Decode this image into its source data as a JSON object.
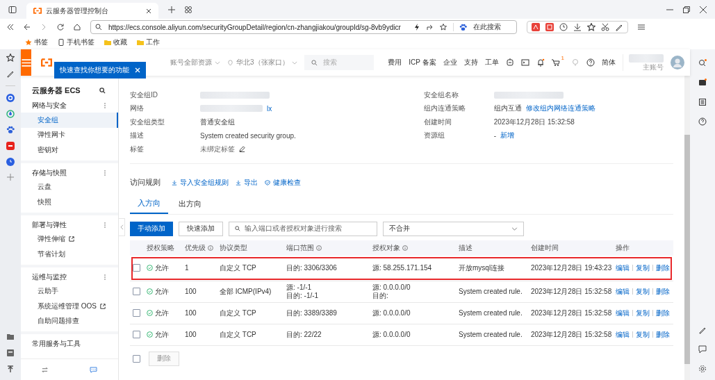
{
  "browser": {
    "tab_title": "云服务器管理控制台",
    "url": "https://ecs.console.aliyun.com/securityGroupDetail/region/cn-zhangjiakou/groupId/sg-8vb9ydicr",
    "search_placeholder": "在此搜索",
    "bookmarks": [
      {
        "label": "书签",
        "kind": "star"
      },
      {
        "label": "手机书签",
        "kind": "phone"
      },
      {
        "label": "收藏",
        "kind": "folder"
      },
      {
        "label": "工作",
        "kind": "folder"
      }
    ]
  },
  "topbar": {
    "resource_scope": "账号全部资源",
    "region": "华北3（张家口）",
    "search_placeholder": "搜索",
    "links": [
      "费用",
      "ICP 备案",
      "企业",
      "支持",
      "工单"
    ],
    "cart_count": "1",
    "language": "简体",
    "account_label": "主账号"
  },
  "tooltip": "快速查找你想要的功能",
  "sidebar": {
    "title": "云服务器 ECS",
    "sections": [
      {
        "title": "网络与安全",
        "items": [
          {
            "label": "安全组",
            "selected": true,
            "external": false
          },
          {
            "label": "弹性网卡",
            "selected": false,
            "external": false
          },
          {
            "label": "密钥对",
            "selected": false,
            "external": false
          }
        ]
      },
      {
        "title": "存储与快照",
        "items": [
          {
            "label": "云盘",
            "selected": false,
            "external": false
          },
          {
            "label": "快照",
            "selected": false,
            "external": false
          }
        ]
      },
      {
        "title": "部署与弹性",
        "items": [
          {
            "label": "弹性伸缩",
            "selected": false,
            "external": true
          },
          {
            "label": "节省计划",
            "selected": false,
            "external": false
          }
        ]
      },
      {
        "title": "运维与监控",
        "items": [
          {
            "label": "云助手",
            "selected": false,
            "external": false
          },
          {
            "label": "系统运维管理 OOS",
            "selected": false,
            "external": true
          },
          {
            "label": "自助问题排查",
            "selected": false,
            "external": false
          }
        ]
      },
      {
        "title": "常用服务与工具"
      }
    ]
  },
  "details": {
    "left": [
      {
        "label": "安全组ID",
        "kind": "redacted"
      },
      {
        "label": "网络",
        "kind": "redacted-link",
        "value": "lx"
      },
      {
        "label": "安全组类型",
        "kind": "text",
        "value": "普通安全组"
      },
      {
        "label": "描述",
        "kind": "text",
        "value": "System created security group."
      },
      {
        "label": "标签",
        "kind": "tag",
        "value": "未绑定标签"
      }
    ],
    "right": [
      {
        "label": "安全组名称",
        "kind": "redacted"
      },
      {
        "label": "组内连通策略",
        "kind": "text-link",
        "value": "组内互通",
        "link": "修改组内网络连通策略"
      },
      {
        "label": "创建时间",
        "kind": "text",
        "value": "2023年12月28日 15:32:58"
      },
      {
        "label": "资源组",
        "kind": "text-link",
        "value": "-",
        "link": "新增"
      }
    ]
  },
  "rules": {
    "title": "访问规则",
    "actions": [
      {
        "label": "导入安全组规则",
        "kind": "download"
      },
      {
        "label": "导出",
        "kind": "download"
      },
      {
        "label": "健康检查",
        "kind": "shield"
      }
    ],
    "tabs": [
      {
        "label": "入方向",
        "selected": true
      },
      {
        "label": "出方向",
        "selected": false
      }
    ],
    "add_button": "手动添加",
    "quick_add_button": "快速添加",
    "search_placeholder": "输入端口或者授权对象进行搜索",
    "merge_select": "不合并",
    "columns": [
      {
        "label": "授权策略",
        "info": false
      },
      {
        "label": "优先级",
        "info": true
      },
      {
        "label": "协议类型",
        "info": false
      },
      {
        "label": "端口范围",
        "info": true
      },
      {
        "label": "授权对象",
        "info": true
      },
      {
        "label": "描述",
        "info": false
      },
      {
        "label": "创建时间",
        "info": false
      },
      {
        "label": "操作",
        "info": false
      }
    ],
    "rows": [
      {
        "checked": false,
        "highlighted": true,
        "policy": "允许",
        "priority": "1",
        "protocol": "自定义 TCP",
        "port": [
          "目的: 3306/3306"
        ],
        "object": [
          "源: 58.255.171.154"
        ],
        "description": "开放mysql连接",
        "created": "2023年12月28日 19:43:23",
        "actions": [
          "编辑",
          "复制",
          "删除"
        ]
      },
      {
        "checked": false,
        "highlighted": false,
        "policy": "允许",
        "priority": "100",
        "protocol": "全部 ICMP(IPv4)",
        "port": [
          "源: -1/-1",
          "目的: -1/-1"
        ],
        "object": [
          "源: 0.0.0.0/0",
          "目的:"
        ],
        "description": "System created rule.",
        "created": "2023年12月28日 15:32:58",
        "actions": [
          "编辑",
          "复制",
          "删除"
        ]
      },
      {
        "checked": false,
        "highlighted": false,
        "policy": "允许",
        "priority": "100",
        "protocol": "自定义 TCP",
        "port": [
          "目的: 3389/3389"
        ],
        "object": [
          "源: 0.0.0.0/0"
        ],
        "description": "System created rule.",
        "created": "2023年12月28日 15:32:58",
        "actions": [
          "编辑",
          "复制",
          "删除"
        ]
      },
      {
        "checked": false,
        "highlighted": false,
        "policy": "允许",
        "priority": "100",
        "protocol": "自定义 TCP",
        "port": [
          "目的: 22/22"
        ],
        "object": [
          "源: 0.0.0.0/0"
        ],
        "description": "System created rule.",
        "created": "2023年12月28日 15:32:58",
        "actions": [
          "编辑",
          "复制",
          "删除"
        ]
      }
    ],
    "select_all_checked": false,
    "delete_button": {
      "label": "删除",
      "disabled": true
    }
  }
}
